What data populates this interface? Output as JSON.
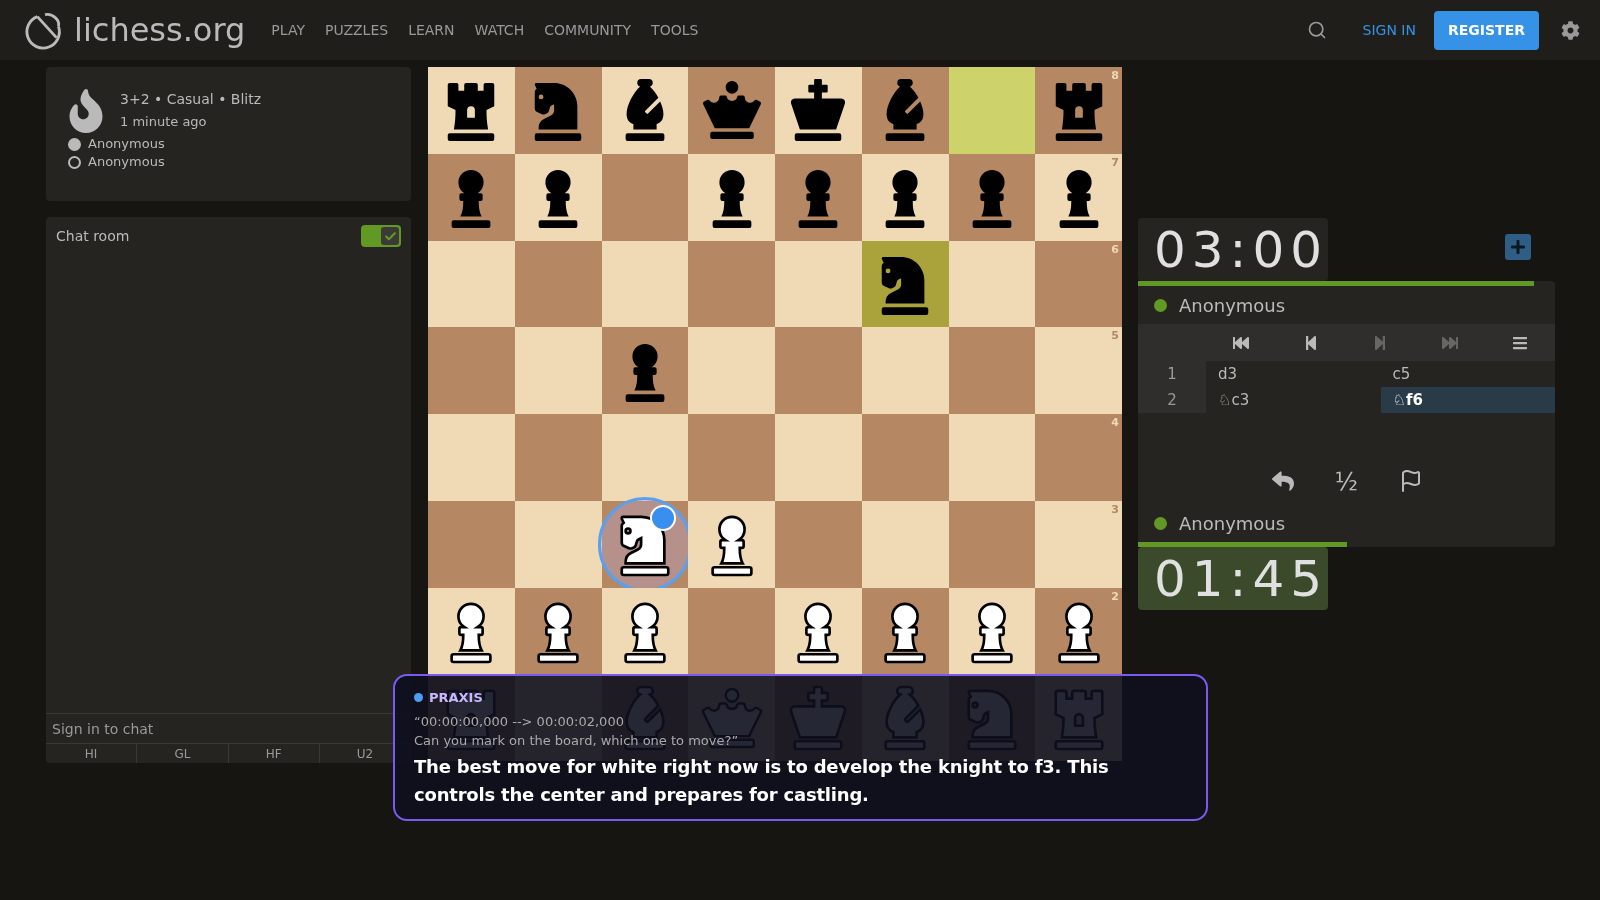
{
  "header": {
    "logo": "lichess.org",
    "nav": [
      "PLAY",
      "PUZZLES",
      "LEARN",
      "WATCH",
      "COMMUNITY",
      "TOOLS"
    ],
    "sign_in": "SIGN IN",
    "register": "REGISTER"
  },
  "game": {
    "title": "3+2 • Casual • Blitz",
    "time": "1 minute ago",
    "players": [
      {
        "name": "Anonymous",
        "white": true
      },
      {
        "name": "Anonymous",
        "white": false
      }
    ]
  },
  "chat": {
    "title": "Chat room",
    "on": true,
    "placeholder": "Sign in to chat",
    "presets": [
      "HI",
      "GL",
      "HF",
      "U2"
    ]
  },
  "board": {
    "ranks": [
      {
        "label": "8",
        "squares": [
          {
            "kind": "rook",
            "white": false,
            "highlight": false
          },
          {
            "kind": "knight",
            "white": false,
            "highlight": false
          },
          {
            "kind": "bishop",
            "white": false,
            "highlight": false
          },
          {
            "kind": "queen",
            "white": false,
            "highlight": false
          },
          {
            "kind": "king",
            "white": false,
            "highlight": false
          },
          {
            "kind": "bishop",
            "white": false,
            "highlight": false
          },
          {
            "kind": "empty",
            "highlight": true
          },
          {
            "kind": "rook",
            "white": false,
            "highlight": false
          }
        ]
      },
      {
        "label": "7",
        "squares": [
          {
            "kind": "pawn",
            "white": false,
            "highlight": false
          },
          {
            "kind": "pawn",
            "white": false,
            "highlight": false
          },
          {
            "kind": "empty",
            "highlight": false
          },
          {
            "kind": "pawn",
            "white": false,
            "highlight": false
          },
          {
            "kind": "pawn",
            "white": false,
            "highlight": false
          },
          {
            "kind": "pawn",
            "white": false,
            "highlight": false
          },
          {
            "kind": "pawn",
            "white": false,
            "highlight": false
          },
          {
            "kind": "pawn",
            "white": false,
            "highlight": false
          }
        ]
      },
      {
        "label": "6",
        "squares": [
          {
            "kind": "empty",
            "highlight": false
          },
          {
            "kind": "empty",
            "highlight": false
          },
          {
            "kind": "empty",
            "highlight": false
          },
          {
            "kind": "empty",
            "highlight": false
          },
          {
            "kind": "empty",
            "highlight": false
          },
          {
            "kind": "knight",
            "white": false,
            "highlight": true
          },
          {
            "kind": "empty",
            "highlight": false
          },
          {
            "kind": "empty",
            "highlight": false
          }
        ]
      },
      {
        "label": "5",
        "squares": [
          {
            "kind": "empty",
            "highlight": false
          },
          {
            "kind": "empty",
            "highlight": false
          },
          {
            "kind": "pawn",
            "white": false,
            "highlight": false
          },
          {
            "kind": "empty",
            "highlight": false
          },
          {
            "kind": "empty",
            "highlight": false
          },
          {
            "kind": "empty",
            "highlight": false
          },
          {
            "kind": "empty",
            "highlight": false
          },
          {
            "kind": "empty",
            "highlight": false
          }
        ]
      },
      {
        "label": "4",
        "squares": [
          {
            "kind": "empty",
            "highlight": false
          },
          {
            "kind": "empty",
            "highlight": false
          },
          {
            "kind": "empty",
            "highlight": false
          },
          {
            "kind": "empty",
            "highlight": false
          },
          {
            "kind": "empty",
            "highlight": false
          },
          {
            "kind": "empty",
            "highlight": false
          },
          {
            "kind": "empty",
            "highlight": false
          },
          {
            "kind": "empty",
            "highlight": false
          }
        ]
      },
      {
        "label": "3",
        "squares": [
          {
            "kind": "empty",
            "highlight": false
          },
          {
            "kind": "empty",
            "highlight": false
          },
          {
            "kind": "knight",
            "white": true,
            "highlight": false,
            "marked": true
          },
          {
            "kind": "pawn",
            "white": true,
            "highlight": false
          },
          {
            "kind": "empty",
            "highlight": false
          },
          {
            "kind": "empty",
            "highlight": false
          },
          {
            "kind": "empty",
            "highlight": false
          },
          {
            "kind": "empty",
            "highlight": false
          }
        ]
      },
      {
        "label": "2",
        "squares": [
          {
            "kind": "pawn",
            "white": true,
            "highlight": false
          },
          {
            "kind": "pawn",
            "white": true,
            "highlight": false
          },
          {
            "kind": "pawn",
            "white": true,
            "highlight": false
          },
          {
            "kind": "empty",
            "highlight": false
          },
          {
            "kind": "pawn",
            "white": true,
            "highlight": false
          },
          {
            "kind": "pawn",
            "white": true,
            "highlight": false
          },
          {
            "kind": "pawn",
            "white": true,
            "highlight": false
          },
          {
            "kind": "pawn",
            "white": true,
            "highlight": false
          }
        ]
      },
      {
        "squares": [
          {
            "kind": "rook",
            "white": true
          },
          {
            "kind": "empty"
          },
          {
            "kind": "bishop",
            "white": true
          },
          {
            "kind": "queen",
            "white": true
          },
          {
            "kind": "king",
            "white": true
          },
          {
            "kind": "bishop",
            "white": true
          },
          {
            "kind": "knight",
            "white": true
          },
          {
            "kind": "rook",
            "white": true
          }
        ]
      }
    ]
  },
  "clocks": {
    "top": {
      "time": "03:00",
      "level": 0.95,
      "active": false,
      "player": "Anonymous"
    },
    "bottom": {
      "time": "01:45",
      "level": 0.5,
      "active": true,
      "player": "Anonymous"
    }
  },
  "move_nav": [
    {
      "kind": "first",
      "disabled": false
    },
    {
      "kind": "prev",
      "disabled": false
    },
    {
      "kind": "next",
      "disabled": true
    },
    {
      "kind": "last",
      "disabled": true
    },
    {
      "kind": "menu",
      "disabled": false
    }
  ],
  "moves": [
    {
      "number": "1",
      "white": {
        "san": "d3",
        "selected": false
      },
      "black": {
        "san": "c5",
        "selected": false
      }
    },
    {
      "number": "2",
      "white": {
        "san": "♘c3",
        "selected": false
      },
      "black": {
        "san": "♘f6",
        "selected": true
      }
    }
  ],
  "actions": [
    {
      "kind": "takeback"
    },
    {
      "kind": "draw",
      "label": "½"
    },
    {
      "kind": "resign"
    }
  ],
  "caption": {
    "speaker": "PRAXIS",
    "timing": "“00:00:00,000 --> 00:00:02,000",
    "question": "Can you mark on the board, which one to move?”",
    "answer": "The best move for white right now is to develop the knight to f3. This controls the center and prepares for castling."
  }
}
